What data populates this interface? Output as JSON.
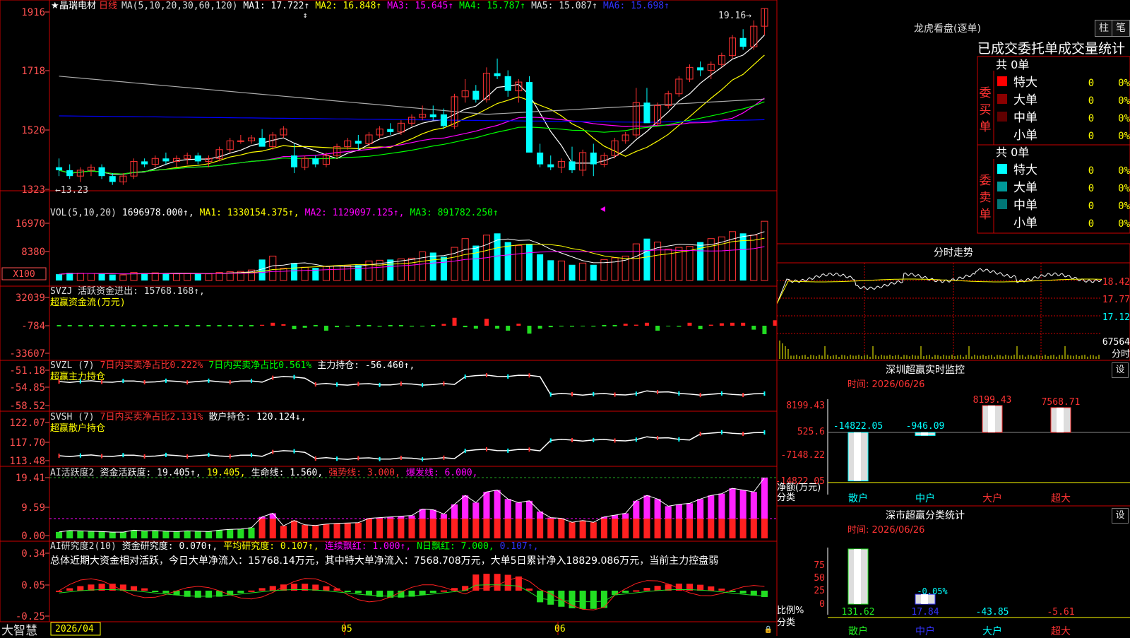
{
  "stock": {
    "name": "晶瑞电材",
    "star": "★",
    "period": "日线",
    "brand": "大智慧"
  },
  "colors": {
    "up": "#ff3333",
    "down": "#00ffff",
    "ma1": "#ffffff",
    "ma2": "#ffff00",
    "ma3": "#ff00ff",
    "ma4": "#00ff00",
    "ma5": "#aaaaaa",
    "ma6": "#0000ff",
    "axis": "#cc0000",
    "label": "#ff5050"
  },
  "legends": {
    "main": [
      {
        "text": "MA(5,10,20,30,60,120)",
        "color": "#dddddd"
      },
      {
        "text": "MA1: 17.722↑",
        "color": "#ffffff"
      },
      {
        "text": "MA2: 16.848↑",
        "color": "#ffff00"
      },
      {
        "text": "MA3: 15.645↑",
        "color": "#ff00ff"
      },
      {
        "text": "MA4: 15.787↑",
        "color": "#00ff00"
      },
      {
        "text": "MA5: 15.087↑",
        "color": "#dddddd"
      },
      {
        "text": "MA6: 15.698↑",
        "color": "#3333ff"
      }
    ],
    "vol": [
      {
        "text": "VOL(5,10,20)",
        "color": "#dddddd"
      },
      {
        "text": "1696978.000↑,",
        "color": "#ffffff"
      },
      {
        "text": "MA1: 1330154.375↑,",
        "color": "#ffff00"
      },
      {
        "text": "MA2: 1129097.125↑,",
        "color": "#ff00ff"
      },
      {
        "text": "MA3: 891782.250↑",
        "color": "#00ff00"
      }
    ],
    "svzj": [
      {
        "text": "SVZJ  活跃资金进出: 15768.168↑,",
        "color": "#dddddd"
      }
    ],
    "svzj2": [
      {
        "text": "超赢资金流(万元)",
        "color": "#ffff00"
      }
    ],
    "svzl": [
      {
        "text": "SVZL (7)",
        "color": "#dddddd"
      },
      {
        "text": "7日内买卖净占比0.222%",
        "color": "#ff3333"
      },
      {
        "text": "7日内买卖净占比0.561%",
        "color": "#00ff00"
      },
      {
        "text": "主力持仓: -56.460↑,",
        "color": "#ffffff"
      }
    ],
    "svzl2": [
      {
        "text": "超赢主力持仓",
        "color": "#ffff00"
      }
    ],
    "svsh": [
      {
        "text": "SVSH (7)",
        "color": "#dddddd"
      },
      {
        "text": "7日内买卖净占比2.131%",
        "color": "#ff3333"
      },
      {
        "text": "散户持仓: 120.124↓,",
        "color": "#ffffff"
      }
    ],
    "svsh2": [
      {
        "text": "超赢散户持仓",
        "color": "#ffff00"
      }
    ],
    "ai1": [
      {
        "text": "AI活跃度2",
        "color": "#dddddd"
      },
      {
        "text": "资金活跃度: 19.405↑,",
        "color": "#ffffff"
      },
      {
        "text": "19.405,",
        "color": "#ffff00"
      },
      {
        "text": "生命线: 1.560,",
        "color": "#ffffff"
      },
      {
        "text": "强势线: 3.000,",
        "color": "#ff3333"
      },
      {
        "text": "爆发线: 6.000,",
        "color": "#ff00ff"
      }
    ],
    "ai2": [
      {
        "text": "AI研究度2(10)",
        "color": "#dddddd"
      },
      {
        "text": "资金研究度: 0.070↑,",
        "color": "#ffffff"
      },
      {
        "text": "平均研究度: 0.107↑,",
        "color": "#ffff00"
      },
      {
        "text": "连续飘红: 1.000↑,",
        "color": "#ff00ff"
      },
      {
        "text": "N日飘红: 7.000,",
        "color": "#00ff00"
      },
      {
        "text": "0.107↑,",
        "color": "#3333ff"
      }
    ]
  },
  "summary": "总体近期大资金相对活跃，今日大单净流入：15768.14万元，其中特大单净流入：7568.708万元，大单5日累计净入18829.086万元，当前主力控盘弱",
  "axis_labels": {
    "main": [
      "1916",
      "1718",
      "1520",
      "1323"
    ],
    "vol": [
      "16970",
      "8380",
      "X100"
    ],
    "svzj": [
      "32039",
      "-784",
      "-33607"
    ],
    "svzl": [
      "-51.18",
      "-54.85",
      "-58.52"
    ],
    "svsh": [
      "122.07",
      "117.70",
      "113.48"
    ],
    "ai1": [
      "19.41",
      "9.59",
      "0.00"
    ],
    "ai2": [
      "0.34",
      "0.05",
      "-0.25"
    ]
  },
  "annotations": {
    "high": "19.16",
    "low": "13.23"
  },
  "dates": {
    "start": "2026/04",
    "m1": "05",
    "m2": "06"
  },
  "panel_lhb": {
    "title": "龙虎看盘(逐单)",
    "btn1": "柱",
    "btn2": "笔",
    "subtitle": "已成交委托单成交量统计",
    "buy": {
      "side": "委买单",
      "total": "共 0单",
      "rows": [
        {
          "label": "特大",
          "n": "0",
          "p": "0%"
        },
        {
          "label": "大单",
          "n": "0",
          "p": "0%"
        },
        {
          "label": "中单",
          "n": "0",
          "p": "0%"
        },
        {
          "label": "小单",
          "n": "0",
          "p": "0%"
        }
      ]
    },
    "sell": {
      "side": "委卖单",
      "total": "共 0单",
      "rows": [
        {
          "label": "特大",
          "n": "0",
          "p": "0%"
        },
        {
          "label": "大单",
          "n": "0",
          "p": "0%"
        },
        {
          "label": "中单",
          "n": "0",
          "p": "0%"
        },
        {
          "label": "小单",
          "n": "0",
          "p": "0%"
        }
      ]
    }
  },
  "panel_intraday": {
    "title": "分时走势",
    "labels": [
      "18.42",
      "17.77",
      "17.12",
      "67564",
      "分时"
    ]
  },
  "panel_monitor": {
    "title": "深圳超赢实时监控",
    "btn": "设",
    "time": "时间: 2026/06/26",
    "y_labels": [
      "8199.43",
      "525.6",
      "-7148.22",
      "-14822.05"
    ],
    "y_title": "净额(万元)",
    "x_title": "分类",
    "bars": [
      {
        "cat": "散户",
        "value": "-14822.05"
      },
      {
        "cat": "中户",
        "value": "-946.09"
      },
      {
        "cat": "大户",
        "value": "8199.43"
      },
      {
        "cat": "超大",
        "value": "7568.71"
      }
    ]
  },
  "panel_classify": {
    "title": "深市超赢分类统计",
    "btn": "设",
    "time": "时间: 2026/06/26",
    "y_labels": [
      "75",
      "50",
      "25",
      "0"
    ],
    "y_title": "比例%",
    "x_title": "分类",
    "bars": [
      {
        "cat": "散户",
        "value": "131.62"
      },
      {
        "cat": "中户",
        "value": "17.84"
      },
      {
        "cat": "大户",
        "value": "-43.85"
      },
      {
        "cat": "超大",
        "value": "-5.61"
      }
    ],
    "bar_label": "-0.05%"
  },
  "chart_data": [
    {
      "type": "candlestick",
      "title": "",
      "ylim": [
        13.0,
        19.3
      ],
      "x": [
        "2026/04",
        "05",
        "06"
      ],
      "ohlc": [
        [
          13.8,
          14.1,
          13.5,
          13.7
        ],
        [
          13.7,
          13.9,
          13.4,
          13.5
        ],
        [
          13.5,
          13.8,
          13.3,
          13.7
        ],
        [
          13.7,
          13.9,
          13.5,
          13.8
        ],
        [
          13.8,
          13.9,
          13.4,
          13.5
        ],
        [
          13.5,
          13.6,
          13.2,
          13.3
        ],
        [
          13.3,
          13.6,
          13.2,
          13.5
        ],
        [
          13.5,
          14.1,
          13.4,
          14.0
        ],
        [
          14.0,
          14.1,
          13.8,
          13.9
        ],
        [
          13.9,
          14.2,
          13.8,
          14.1
        ],
        [
          14.1,
          14.3,
          13.9,
          14.0
        ],
        [
          14.0,
          14.2,
          13.8,
          14.1
        ],
        [
          14.1,
          14.3,
          13.9,
          14.2
        ],
        [
          14.2,
          14.3,
          13.9,
          14.0
        ],
        [
          14.0,
          14.2,
          13.8,
          14.1
        ],
        [
          14.1,
          14.5,
          14.0,
          14.4
        ],
        [
          14.4,
          14.8,
          14.3,
          14.7
        ],
        [
          14.7,
          14.9,
          14.6,
          14.7
        ],
        [
          14.7,
          14.9,
          14.6,
          14.8
        ],
        [
          14.8,
          15.1,
          14.7,
          14.5
        ],
        [
          14.5,
          15.0,
          14.4,
          14.9
        ],
        [
          14.9,
          15.2,
          14.8,
          15.1
        ],
        [
          14.2,
          14.6,
          13.6,
          13.8
        ],
        [
          13.8,
          14.2,
          13.7,
          14.1
        ],
        [
          14.1,
          14.2,
          13.8,
          13.9
        ],
        [
          13.9,
          14.3,
          13.8,
          14.2
        ],
        [
          14.2,
          14.6,
          14.1,
          14.5
        ],
        [
          14.5,
          14.8,
          14.4,
          14.7
        ],
        [
          14.7,
          14.9,
          14.4,
          14.6
        ],
        [
          14.6,
          15.0,
          14.5,
          14.9
        ],
        [
          14.9,
          15.2,
          14.8,
          15.1
        ],
        [
          15.1,
          15.3,
          14.9,
          15.0
        ],
        [
          15.0,
          15.4,
          14.9,
          15.3
        ],
        [
          15.3,
          15.6,
          15.2,
          15.5
        ],
        [
          15.5,
          15.9,
          15.4,
          15.6
        ],
        [
          15.6,
          15.9,
          15.4,
          15.5
        ],
        [
          15.6,
          15.8,
          15.1,
          15.2
        ],
        [
          15.2,
          16.3,
          15.1,
          16.2
        ],
        [
          16.2,
          16.8,
          16.0,
          16.4
        ],
        [
          16.4,
          16.6,
          16.0,
          16.1
        ],
        [
          16.1,
          17.2,
          16.0,
          17.0
        ],
        [
          17.0,
          17.5,
          16.8,
          16.9
        ],
        [
          16.9,
          17.1,
          16.2,
          16.4
        ],
        [
          16.4,
          16.8,
          16.0,
          16.7
        ],
        [
          16.7,
          16.9,
          15.6,
          14.3
        ],
        [
          14.3,
          14.6,
          13.8,
          13.9
        ],
        [
          13.9,
          14.2,
          13.7,
          13.8
        ],
        [
          13.8,
          14.1,
          13.6,
          14.0
        ],
        [
          14.0,
          14.5,
          13.6,
          13.7
        ],
        [
          13.7,
          14.4,
          13.5,
          14.3
        ],
        [
          14.3,
          14.6,
          13.5,
          13.9
        ],
        [
          13.9,
          14.3,
          13.8,
          14.2
        ],
        [
          14.2,
          14.8,
          14.1,
          14.7
        ],
        [
          14.7,
          15.0,
          14.6,
          14.9
        ],
        [
          14.9,
          16.5,
          14.8,
          16.0
        ],
        [
          16.0,
          16.5,
          15.5,
          15.3
        ],
        [
          15.3,
          16.0,
          15.2,
          15.9
        ],
        [
          15.9,
          16.4,
          15.8,
          16.3
        ],
        [
          16.3,
          16.9,
          16.2,
          16.8
        ],
        [
          16.8,
          17.3,
          16.7,
          17.2
        ],
        [
          17.2,
          17.4,
          16.9,
          17.1
        ],
        [
          17.1,
          17.4,
          16.8,
          17.3
        ],
        [
          17.3,
          17.7,
          17.2,
          17.6
        ],
        [
          17.6,
          18.3,
          17.5,
          18.2
        ],
        [
          18.2,
          18.5,
          17.8,
          17.9
        ],
        [
          17.9,
          18.8,
          17.8,
          18.6
        ],
        [
          18.6,
          19.2,
          18.3,
          19.2
        ]
      ],
      "series": [
        {
          "name": "MA1"
        },
        {
          "name": "MA2"
        },
        {
          "name": "MA3"
        },
        {
          "name": "MA4"
        },
        {
          "name": "MA5"
        },
        {
          "name": "MA6"
        }
      ]
    },
    {
      "type": "bar",
      "title": "",
      "ylim": [
        0,
        17000
      ],
      "values": [
        1800,
        2200,
        2100,
        2000,
        1900,
        1700,
        1600,
        2300,
        2100,
        2200,
        2000,
        1900,
        2100,
        2000,
        1900,
        2300,
        2500,
        2600,
        3000,
        6000,
        7000,
        3500,
        5000,
        3800,
        3600,
        4000,
        4200,
        4300,
        4400,
        5600,
        5800,
        6000,
        6200,
        6400,
        8200,
        8000,
        6800,
        9500,
        12000,
        10000,
        13000,
        13500,
        11000,
        10000,
        10500,
        7500,
        5800,
        5600,
        4500,
        5000,
        4500,
        6000,
        6500,
        7000,
        10500,
        12000,
        11000,
        9000,
        9500,
        9800,
        11000,
        12000,
        12500,
        14000,
        13500,
        13000,
        16970
      ]
    },
    {
      "type": "bar",
      "title": "",
      "ylim": [
        -33607,
        32039
      ],
      "values": [
        -200,
        -300,
        -250,
        -200,
        -100,
        -250,
        -500,
        -300,
        -400,
        -300,
        -200,
        -300,
        -400,
        -300,
        -200,
        -300,
        -500,
        -400,
        -300,
        900,
        3000,
        1500,
        -3500,
        -2000,
        -500,
        -5000,
        -1500,
        -800,
        -400,
        -300,
        -1000,
        -400,
        -600,
        -900,
        -800,
        -500,
        1800,
        8000,
        -1500,
        -3000,
        7000,
        -3000,
        -5000,
        2000,
        -8000,
        -3000,
        -1500,
        -800,
        -1000,
        -700,
        -900,
        -500,
        -300,
        2000,
        1000,
        3000,
        -5000,
        -700,
        -1000,
        3000,
        -3500,
        1000,
        2500,
        3000,
        3000,
        -4000,
        -8500,
        5500
      ]
    },
    {
      "type": "line",
      "title": "",
      "ylim": [
        -58.52,
        -51.18
      ]
    },
    {
      "type": "line",
      "title": "",
      "ylim": [
        113.48,
        122.07
      ]
    },
    {
      "type": "bar",
      "title": "",
      "ylim": [
        0,
        19.41
      ]
    },
    {
      "type": "bar",
      "title": "",
      "ylim": [
        -0.25,
        0.34
      ]
    }
  ]
}
